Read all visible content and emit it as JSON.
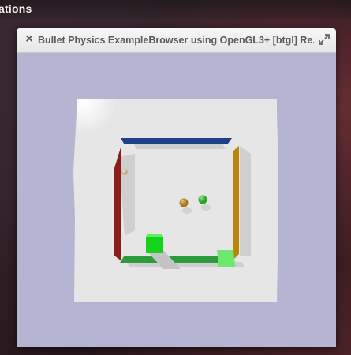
{
  "desktop": {
    "top_bar_label": "ations"
  },
  "window": {
    "title": "Bullet Physics ExampleBrowser using OpenGL3+ [btgl] Re...",
    "close_glyph": "×",
    "close_icon": "close-icon",
    "maximize_icon": "maximize-icon"
  },
  "scene": {
    "background_color": "#b5b4d3",
    "ground_color": "#e6e6e6",
    "walls": {
      "top": "#1f3f8a",
      "left": "#8a1c1c",
      "right": "#b8860b",
      "bottom": "#2e9a3e"
    },
    "objects": [
      {
        "kind": "sphere",
        "color": "#e8d9a0"
      },
      {
        "kind": "sphere",
        "color": "#c9870a"
      },
      {
        "kind": "sphere",
        "color": "#17c61a"
      },
      {
        "kind": "cube",
        "color": "#14d31a"
      },
      {
        "kind": "cube",
        "color": "#6fe86f"
      }
    ]
  }
}
